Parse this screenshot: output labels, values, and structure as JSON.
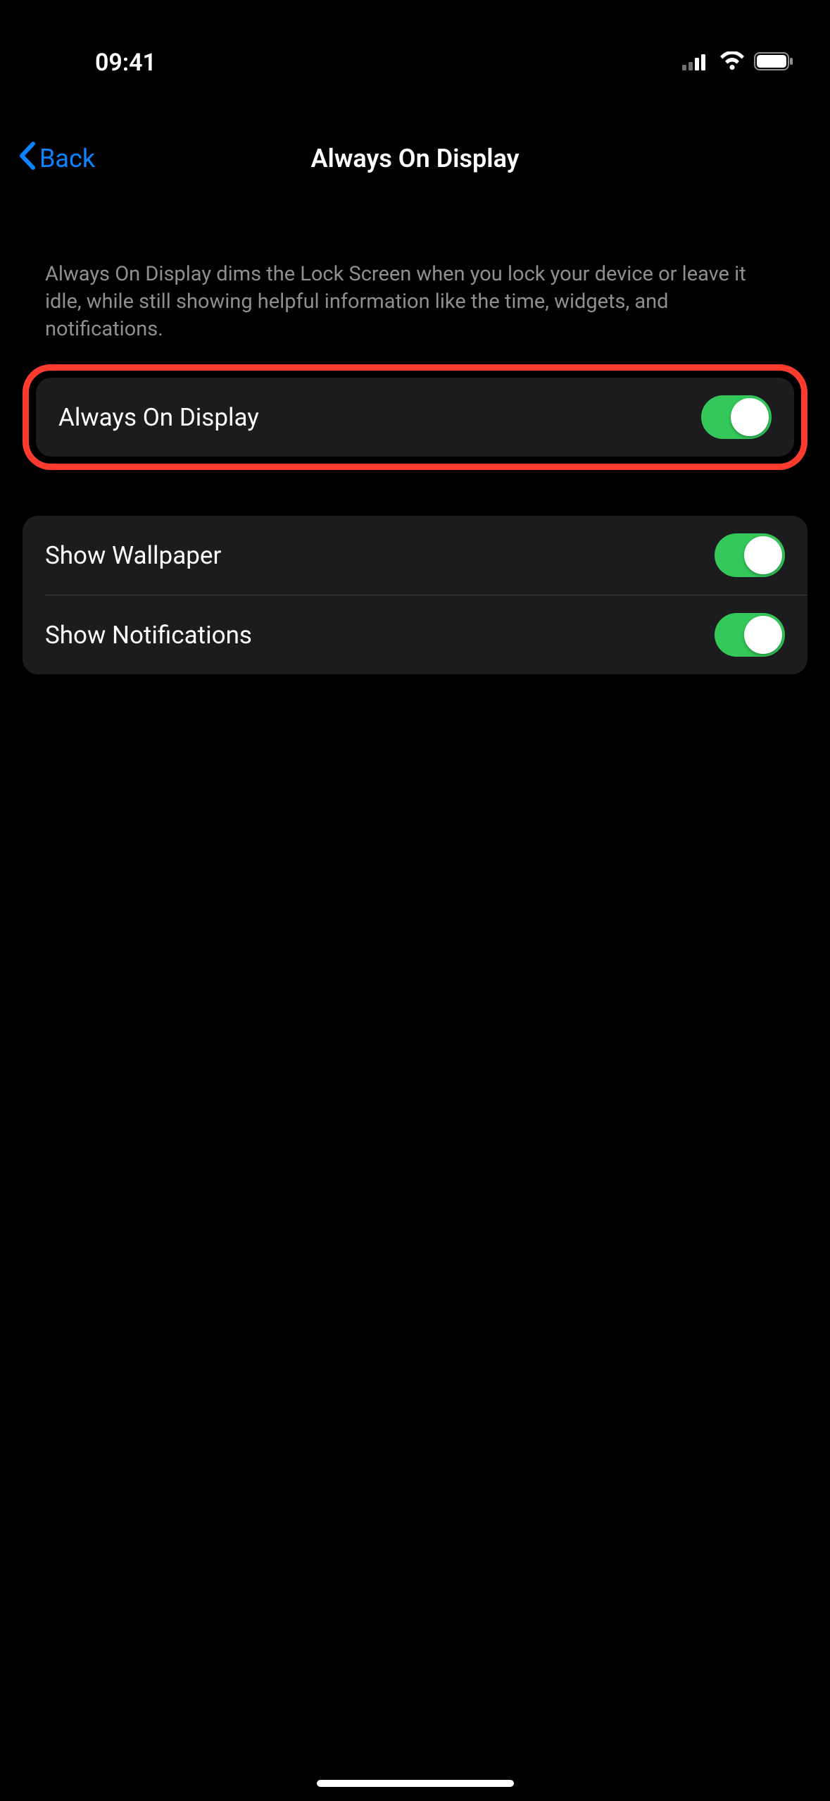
{
  "statusBar": {
    "time": "09:41"
  },
  "nav": {
    "backLabel": "Back",
    "title": "Always On Display"
  },
  "description": "Always On Display dims the Lock Screen when you lock your device or leave it idle, while still showing helpful information like the time, widgets, and notifications.",
  "settings": {
    "alwaysOnDisplay": {
      "label": "Always On Display",
      "enabled": true
    },
    "showWallpaper": {
      "label": "Show Wallpaper",
      "enabled": true
    },
    "showNotifications": {
      "label": "Show Notifications",
      "enabled": true
    }
  },
  "colors": {
    "accent": "#0a84ff",
    "highlight": "#ff3b30",
    "toggleOn": "#34c759",
    "cellBackground": "#1c1c1e",
    "secondaryText": "#8e8e93"
  }
}
